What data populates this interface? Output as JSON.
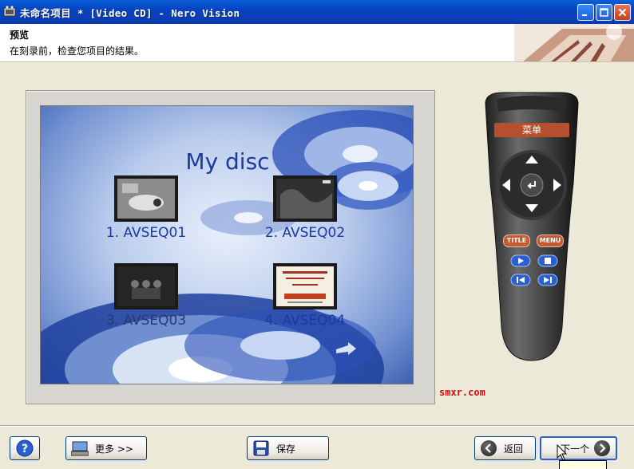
{
  "window": {
    "title": "未命名项目 * [Video CD] - Nero Vision"
  },
  "header": {
    "title": "预览",
    "subtitle": "在刻录前，检查您项目的结果。"
  },
  "preview": {
    "menu_title": "My disc",
    "chapters": [
      {
        "label": "1. AVSEQ01"
      },
      {
        "label": "2. AVSEQ02"
      },
      {
        "label": "3. AVSEQ03"
      },
      {
        "label": "4. AVSEQ04"
      }
    ]
  },
  "remote": {
    "menu_label": "菜单",
    "title_button": "TITLE",
    "menu_button": "MENU"
  },
  "watermark": "smxr.com",
  "footer": {
    "more_label": "更多 >>",
    "save_label": "保存",
    "back_label": "返回",
    "next_label": "下一个"
  },
  "colors": {
    "titlebar": "#0842c0",
    "accent_remote": "#b5502e",
    "menu_text": "#1b3a9a",
    "watermark": "#d01010"
  }
}
